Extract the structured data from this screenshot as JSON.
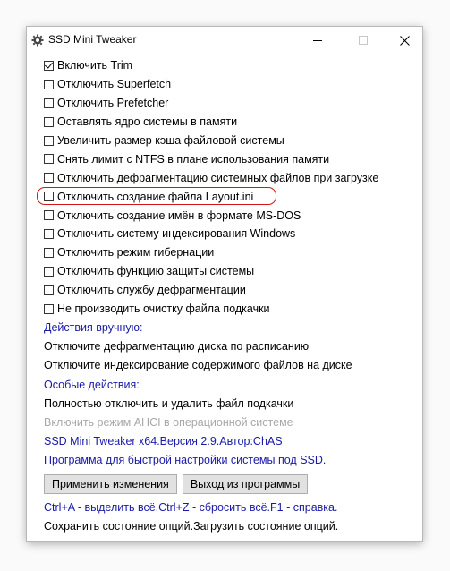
{
  "window": {
    "title": "SSD Mini Tweaker"
  },
  "options": [
    {
      "label": "Включить Trim",
      "checked": true
    },
    {
      "label": "Отключить Superfetch",
      "checked": false
    },
    {
      "label": "Отключить Prefetcher",
      "checked": false
    },
    {
      "label": "Оставлять ядро системы в памяти",
      "checked": false
    },
    {
      "label": "Увеличить размер кэша файловой системы",
      "checked": false
    },
    {
      "label": "Снять лимит с NTFS в плане использования памяти",
      "checked": false
    },
    {
      "label": "Отключить дефрагментацию системных файлов при загрузке",
      "checked": false
    },
    {
      "label": "Отключить создание файла Layout.ini",
      "checked": false
    },
    {
      "label": "Отключить создание имён в формате MS-DOS",
      "checked": false
    },
    {
      "label": "Отключить систему индексирования Windows",
      "checked": false
    },
    {
      "label": "Отключить режим гибернации",
      "checked": false
    },
    {
      "label": "Отключить функцию защиты системы",
      "checked": false
    },
    {
      "label": "Отключить службу дефрагментации",
      "checked": false
    },
    {
      "label": "Не производить очистку файла подкачки",
      "checked": false
    }
  ],
  "manual": {
    "heading": "Действия вручную:",
    "items": [
      "Отключите дефрагментацию диска по расписанию",
      "Отключите индексирование содержимого файлов на диске"
    ]
  },
  "special": {
    "heading": "Особые действия:",
    "items": [
      {
        "label": "Полностью отключить и удалить файл подкачки",
        "enabled": true
      },
      {
        "label": "Включить режим AHCI в операционной системе",
        "enabled": false
      }
    ]
  },
  "info": {
    "version": "SSD Mini Tweaker x64.Версия 2.9.Автор:ChAS",
    "description": "Программа для быстрой настройки системы под SSD."
  },
  "buttons": {
    "apply": "Применить изменения",
    "exit": "Выход из программы"
  },
  "footer": {
    "shortcuts": "Ctrl+A - выделить всё.Ctrl+Z - сбросить всё.F1 - справка.",
    "state": "Сохранить состояние опций.Загрузить состояние опций."
  },
  "colors": {
    "heading_blue": "#1a1aa8",
    "highlight_red": "#d01818",
    "disabled_gray": "#a8a8a8"
  }
}
